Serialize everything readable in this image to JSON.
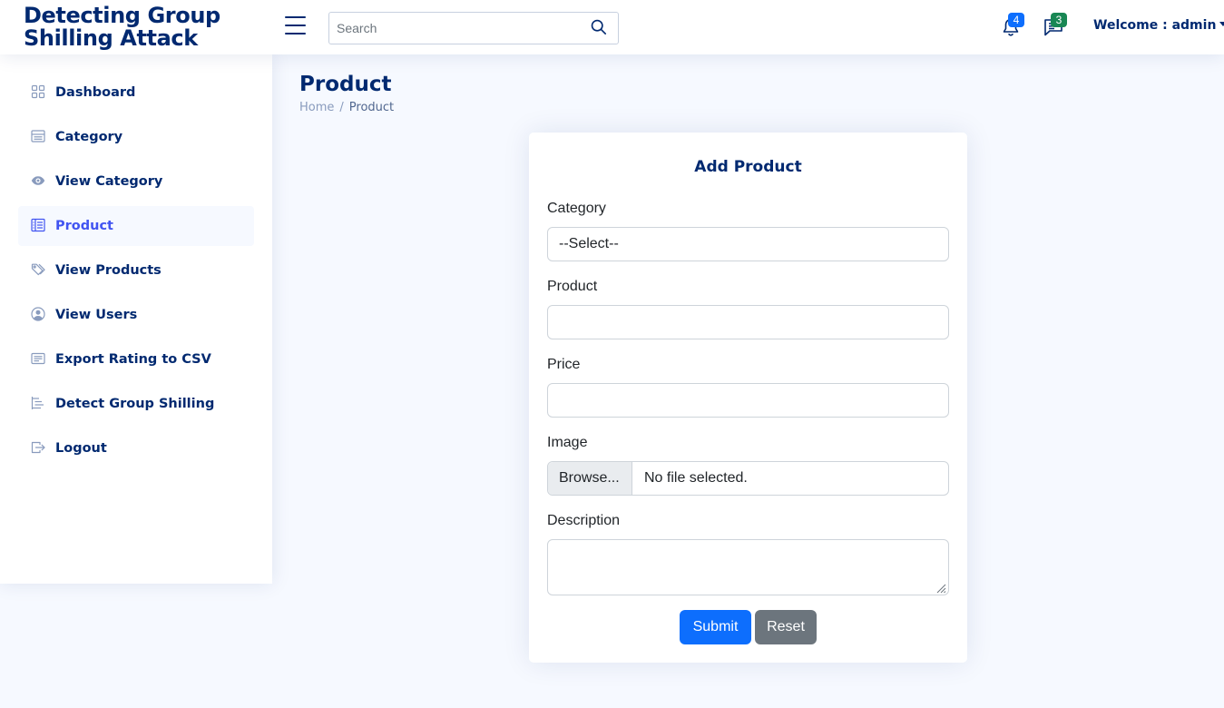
{
  "app": {
    "logo_line1": "Detecting Group",
    "logo_line2": "Shilling Attack"
  },
  "header": {
    "search_placeholder": "Search",
    "notifications_count": "4",
    "messages_count": "3",
    "welcome": "Welcome : admin"
  },
  "sidebar": {
    "items": [
      {
        "label": "Dashboard",
        "icon": "grid-icon"
      },
      {
        "label": "Category",
        "icon": "layout-text-window-icon"
      },
      {
        "label": "View Category",
        "icon": "eye-icon"
      },
      {
        "label": "Product",
        "icon": "list-columns-icon",
        "active": true
      },
      {
        "label": "View Products",
        "icon": "tags-icon"
      },
      {
        "label": "View Users",
        "icon": "person-circle-icon"
      },
      {
        "label": "Export Rating to CSV",
        "icon": "card-text-icon"
      },
      {
        "label": "Detect Group Shilling",
        "icon": "list-nested-icon"
      },
      {
        "label": "Logout",
        "icon": "box-arrow-right-icon"
      }
    ]
  },
  "page": {
    "title": "Product",
    "breadcrumb_home": "Home",
    "breadcrumb_sep": "/",
    "breadcrumb_current": "Product"
  },
  "form": {
    "title": "Add Product",
    "category_label": "Category",
    "category_selected": "--Select--",
    "product_label": "Product",
    "product_value": "",
    "price_label": "Price",
    "price_value": "",
    "image_label": "Image",
    "browse_label": "Browse...",
    "file_status": "No file selected.",
    "description_label": "Description",
    "submit_label": "Submit",
    "reset_label": "Reset"
  },
  "colors": {
    "primary_text": "#012970",
    "accent": "#4154f1",
    "button_primary": "#0d6efd",
    "button_secondary": "#6c757d",
    "badge_blue": "#0d6efd",
    "badge_green": "#198754",
    "page_bg": "#f6f9ff"
  }
}
